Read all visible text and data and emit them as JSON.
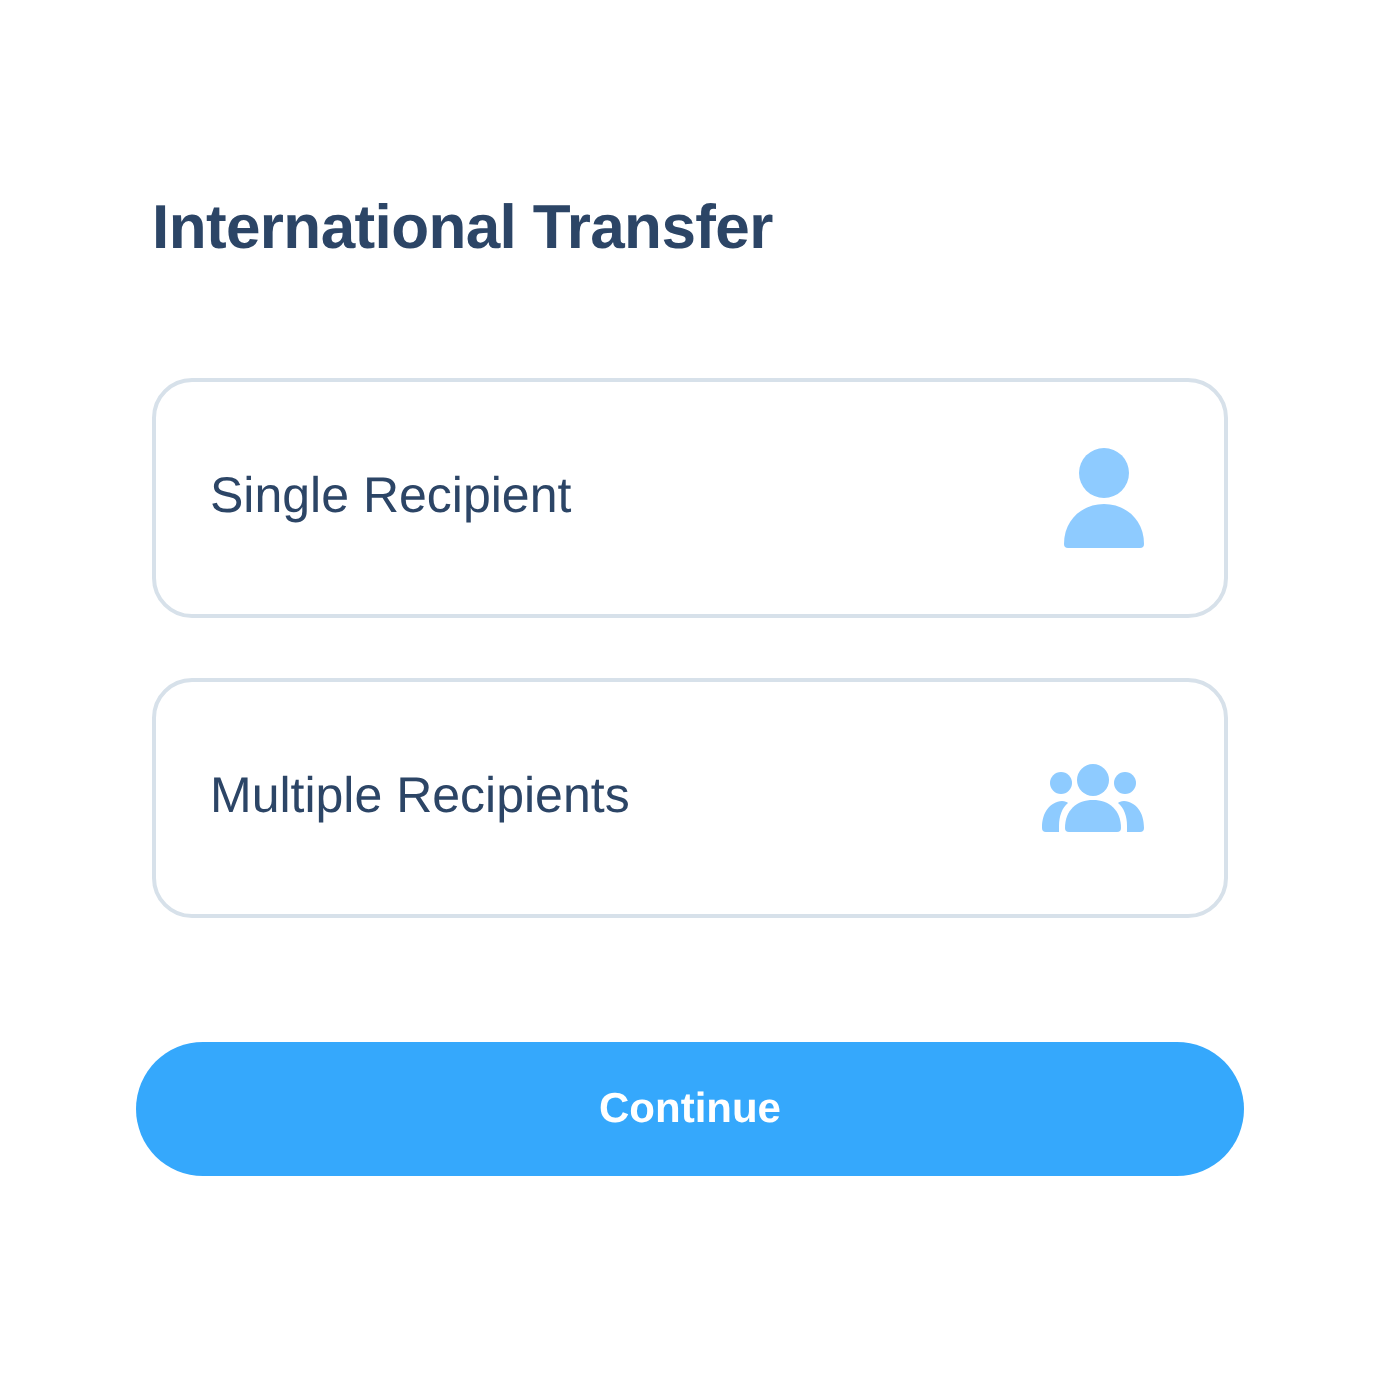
{
  "title": "International Transfer",
  "options": [
    {
      "kind": "single",
      "label": "Single Recipient"
    },
    {
      "kind": "multiple",
      "label": "Multiple Recipients"
    }
  ],
  "continue_button": {
    "label": "Continue"
  }
}
